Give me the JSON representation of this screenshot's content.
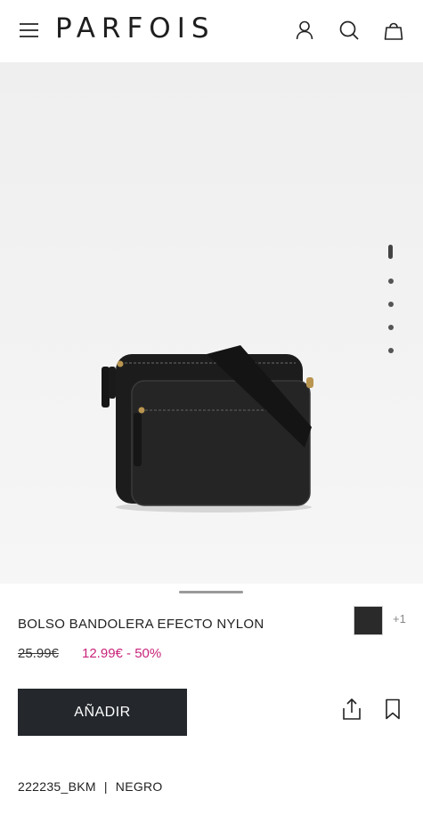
{
  "header": {
    "brand": "PARFOIS",
    "icons": [
      "menu-icon",
      "user-icon",
      "search-icon",
      "bag-icon"
    ]
  },
  "gallery": {
    "image": "black-crossbody-bag",
    "slide_count": 5,
    "active_slide": 1
  },
  "product": {
    "title": "BOLSO BANDOLERA EFECTO NYLON",
    "swatch_color": "#2a2a2a",
    "more_colors": "+1",
    "price_old": "25.99€",
    "price_new": "12.99€ - 50%",
    "add_button": "AÑADIR",
    "reference": "222235_BKM",
    "separator": "|",
    "color_name": "NEGRO"
  },
  "colors": {
    "accent_price": "#c8237a",
    "button_bg": "#24282d"
  }
}
